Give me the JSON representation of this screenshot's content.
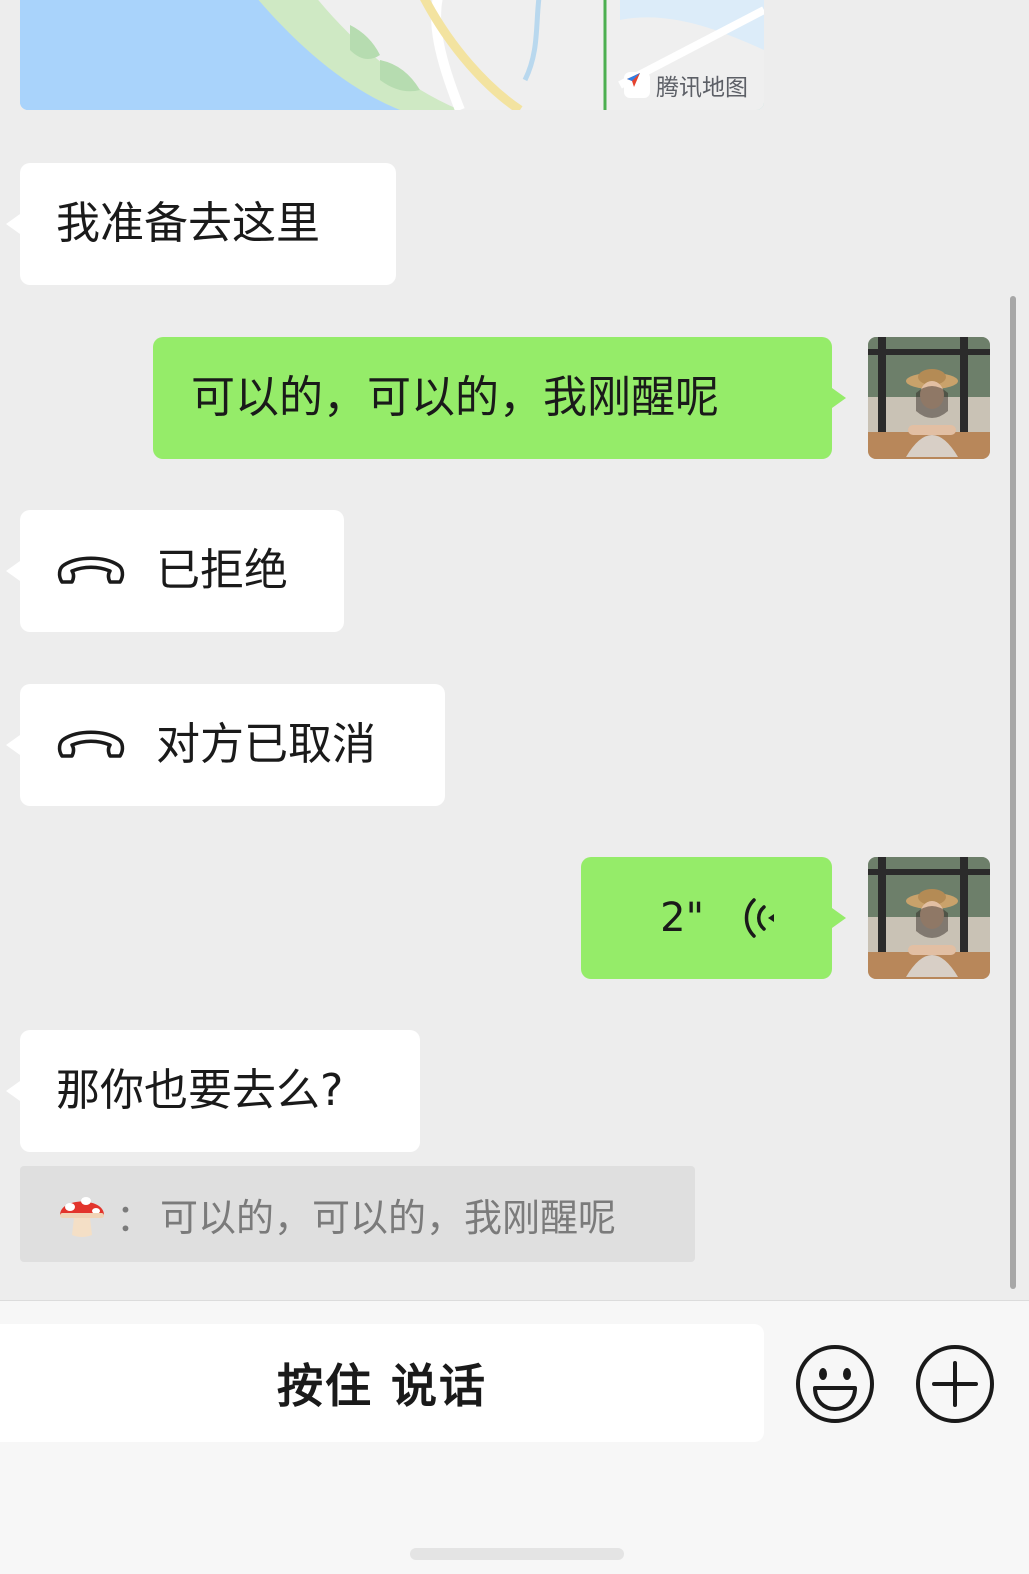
{
  "map": {
    "provider_label": "腾讯地图"
  },
  "messages": [
    {
      "id": "m1",
      "side": "left",
      "text": "我准备去这里"
    },
    {
      "id": "m2",
      "side": "right",
      "text": "可以的，可以的，我刚醒呢"
    },
    {
      "id": "m3",
      "side": "left",
      "type": "call",
      "text": "已拒绝",
      "icon": "phone-hangup-icon"
    },
    {
      "id": "m4",
      "side": "left",
      "type": "call",
      "text": "对方已取消",
      "icon": "phone-hangup-icon"
    },
    {
      "id": "m5",
      "side": "right",
      "type": "voice",
      "duration": "2\"",
      "icon": "voice-wave-icon"
    },
    {
      "id": "m6",
      "side": "left",
      "text": "那你也要去么?"
    }
  ],
  "quote": {
    "sender_icon": "mushroom-emoji",
    "separator": "：",
    "text": "可以的，可以的，我刚醒呢"
  },
  "input_bar": {
    "talk_label": "按住 说话",
    "emoji_icon": "smiley-icon",
    "more_icon": "plus-circle-icon"
  },
  "colors": {
    "chat_background": "#ededed",
    "outgoing_bubble": "#95ec69",
    "incoming_bubble": "#ffffff"
  }
}
